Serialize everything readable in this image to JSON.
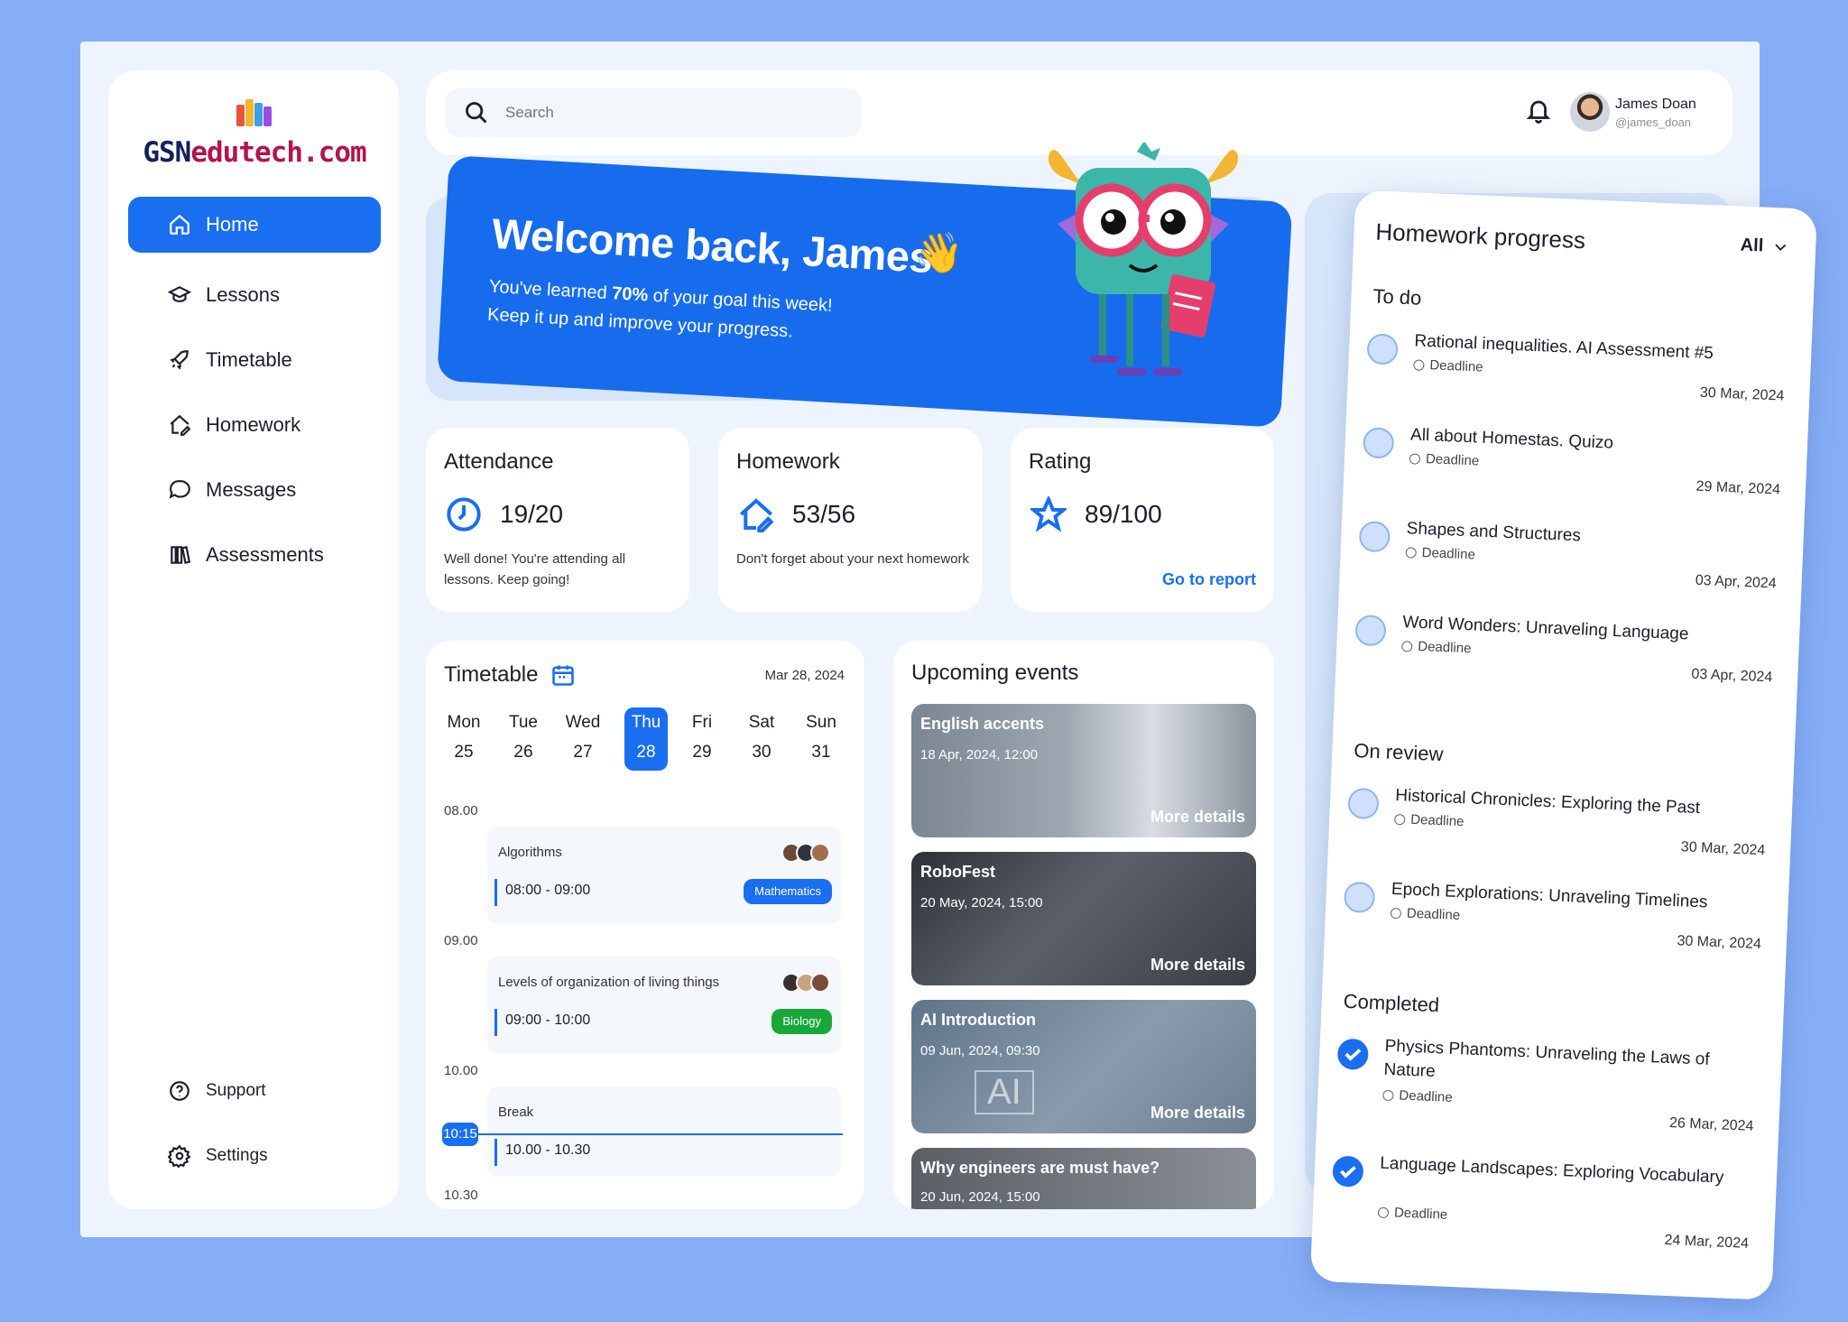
{
  "brand": {
    "name_a": "GSN",
    "name_b": "edutech.com"
  },
  "nav": {
    "items": [
      {
        "label": "Home",
        "icon": "home-icon"
      },
      {
        "label": "Lessons",
        "icon": "graduation-cap-icon"
      },
      {
        "label": "Timetable",
        "icon": "rocket-icon"
      },
      {
        "label": "Homework",
        "icon": "house-pen-icon"
      },
      {
        "label": "Messages",
        "icon": "chat-bubble-icon"
      },
      {
        "label": "Assessments",
        "icon": "books-icon"
      }
    ],
    "support": "Support",
    "settings": "Settings"
  },
  "search": {
    "placeholder": "Search"
  },
  "user": {
    "name": "James Doan",
    "handle": "@james_doan"
  },
  "welcome": {
    "title": "Welcome back, James",
    "line1_pre": "You've learned ",
    "line1_pct": "70%",
    "line1_post": " of your goal this week!",
    "line2": "Keep it up and improve your progress."
  },
  "stats": {
    "attendance": {
      "title": "Attendance",
      "value": "19/20",
      "desc": "Well done! You're attending all lessons. Keep going!"
    },
    "homework": {
      "title": "Homework",
      "value": "53/56",
      "desc": "Don't forget about your next homework"
    },
    "rating": {
      "title": "Rating",
      "value": "89/100",
      "link": "Go to report"
    }
  },
  "timetable": {
    "title": "Timetable",
    "date": "Mar 28, 2024",
    "days": [
      {
        "name": "Mon",
        "num": "25"
      },
      {
        "name": "Tue",
        "num": "26"
      },
      {
        "name": "Wed",
        "num": "27"
      },
      {
        "name": "Thu",
        "num": "28"
      },
      {
        "name": "Fri",
        "num": "29"
      },
      {
        "name": "Sat",
        "num": "30"
      },
      {
        "name": "Sun",
        "num": "31"
      }
    ],
    "selected_day": "Thu",
    "times": [
      "08.00",
      "09.00",
      "10.00",
      "10.30"
    ],
    "now": "10:15",
    "lessons": [
      {
        "name": "Algorithms",
        "time": "08:00 - 09:00",
        "tag": "Mathematics"
      },
      {
        "name": "Levels of organization of living things",
        "time": "09:00 - 10:00",
        "tag": "Biology"
      },
      {
        "name": "Break",
        "time": "10.00 - 10.30",
        "tag": ""
      }
    ]
  },
  "events": {
    "title": "Upcoming events",
    "more": "More details",
    "items": [
      {
        "name": "English accents",
        "date": "18 Apr, 2024, 12:00"
      },
      {
        "name": "RoboFest",
        "date": "20 May, 2024, 15:00"
      },
      {
        "name": "AI Introduction",
        "date": "09 Jun, 2024, 09:30",
        "overlay": "AI"
      },
      {
        "name": "Why engineers are must have?",
        "date": "20 Jun, 2024, 15:00"
      }
    ]
  },
  "homework_progress": {
    "title": "Homework progress",
    "filter": "All",
    "deadline_label": "Deadline",
    "sections": [
      {
        "title": "To do",
        "tasks": [
          {
            "name": "Rational inequalities. AI Assessment #5",
            "date": "30 Mar, 2024"
          },
          {
            "name": "All about Homestas. Quizo",
            "date": "29 Mar, 2024"
          },
          {
            "name": "Shapes and Structures",
            "date": "03 Apr, 2024"
          },
          {
            "name": "Word Wonders: Unraveling Language",
            "date": "03 Apr, 2024"
          }
        ]
      },
      {
        "title": "On review",
        "tasks": [
          {
            "name": "Historical Chronicles: Exploring the Past",
            "date": "30 Mar, 2024"
          },
          {
            "name": "Epoch Explorations: Unraveling Timelines",
            "date": "30 Mar, 2024"
          }
        ]
      },
      {
        "title": "Completed",
        "tasks": [
          {
            "name": "Physics Phantoms: Unraveling the Laws of Nature",
            "date": "26 Mar, 2024"
          },
          {
            "name": "Language Landscapes: Exploring Vocabulary",
            "date": "24 Mar, 2024"
          }
        ]
      }
    ]
  },
  "colors": {
    "accent": "#1a6ef0",
    "background": "#86aef5",
    "brand_dark": "#12205c",
    "brand_red": "#b2154a",
    "biology": "#18a83a"
  }
}
